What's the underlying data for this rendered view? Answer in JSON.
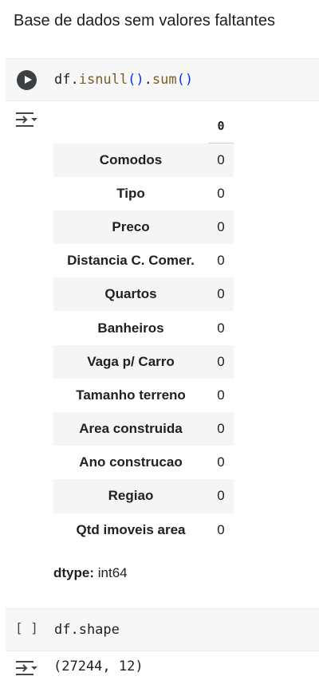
{
  "markdown_heading": "Base de dados sem valores faltantes",
  "cell1": {
    "code": {
      "obj": "df.",
      "fn1": "isnull",
      "paren1": "()",
      "dot": ".",
      "fn2": "sum",
      "paren2": "()"
    },
    "output": {
      "column_header": "0",
      "rows": [
        {
          "label": "Comodos",
          "value": "0"
        },
        {
          "label": "Tipo",
          "value": "0"
        },
        {
          "label": "Preco",
          "value": "0"
        },
        {
          "label": "Distancia C. Comer.",
          "value": "0"
        },
        {
          "label": "Quartos",
          "value": "0"
        },
        {
          "label": "Banheiros",
          "value": "0"
        },
        {
          "label": "Vaga p/ Carro",
          "value": "0"
        },
        {
          "label": "Tamanho terreno",
          "value": "0"
        },
        {
          "label": "Area construida",
          "value": "0"
        },
        {
          "label": "Ano construcao",
          "value": "0"
        },
        {
          "label": "Regiao",
          "value": "0"
        },
        {
          "label": "Qtd imoveis area",
          "value": "0"
        }
      ],
      "dtype_label": "dtype:",
      "dtype_value": "int64"
    }
  },
  "cell2": {
    "exec_count": "[ ]",
    "code": "df.shape",
    "output": "(27244, 12)"
  },
  "icons": {
    "run": "play-circle-icon",
    "output_toggle": "output-expand-icon"
  }
}
